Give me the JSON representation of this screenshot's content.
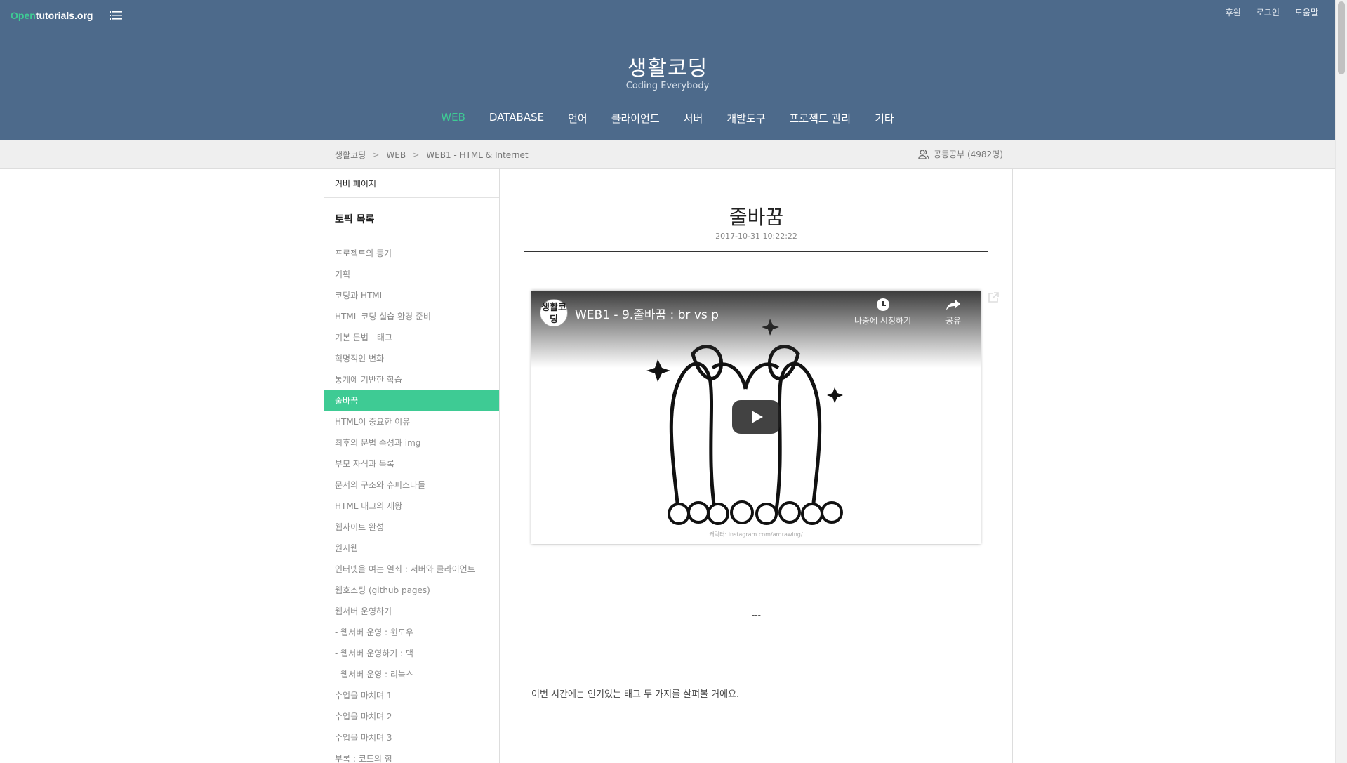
{
  "header": {
    "logo_open": "Open",
    "logo_rest": "tutorials.org",
    "top_links": [
      "후원",
      "로그인",
      "도움말"
    ],
    "site_title": "생활코딩",
    "site_subtitle": "Coding Everybody",
    "nav": [
      "WEB",
      "DATABASE",
      "언어",
      "클라이언트",
      "서버",
      "개발도구",
      "프로젝트 관리",
      "기타"
    ],
    "active_nav": "WEB"
  },
  "breadcrumb": {
    "items": [
      "생활코딩",
      "WEB",
      "WEB1 - HTML & Internet"
    ],
    "separator": ">",
    "study_label": "공동공부 (4982명)"
  },
  "sidebar": {
    "cover_label": "커버 페이지",
    "topic_heading": "토픽 목록",
    "topics": [
      "프로젝트의 동기",
      "기획",
      "코딩과 HTML",
      "HTML 코딩 실습 환경 준비",
      "기본 문법 - 태그",
      "혁명적인 변화",
      "통계에 기반한 학습",
      "줄바꿈",
      "HTML이 중요한 이유",
      "최후의 문법 속성과 img",
      "부모 자식과 목록",
      "문서의 구조와 슈퍼스타들",
      "HTML 태그의 제왕",
      "웹사이트 완성",
      "원시웹",
      "인터넷을 여는 열쇠 : 서버와 클라이언트",
      "웹호스팅 (github pages)",
      "웹서버 운영하기",
      "- 웹서버 운영 : 윈도우",
      "- 웹서버 운영하기 : 맥",
      "- 웹서버 운영 : 리눅스",
      "수업을 마치며 1",
      "수업을 마치며 2",
      "수업을 마치며 3",
      "부록 : 코드의 힘"
    ],
    "active_index": 7
  },
  "article": {
    "title": "줄바꿈",
    "date": "2017-10-31 10:22:22",
    "video": {
      "channel_badge": "생활코딩",
      "title": "WEB1 - 9.줄바꿈 : br vs p",
      "watch_later": "나중에 시청하기",
      "share": "공유",
      "credit": "캐릭터: instagram.com/ardrawing/"
    },
    "separator_text": "---",
    "paragraph": "이번 시간에는 인기있는 태그 두 가지를 살펴볼 거에요."
  },
  "colors": {
    "header_bg": "#4d6a8b",
    "accent": "#3ecb94"
  }
}
